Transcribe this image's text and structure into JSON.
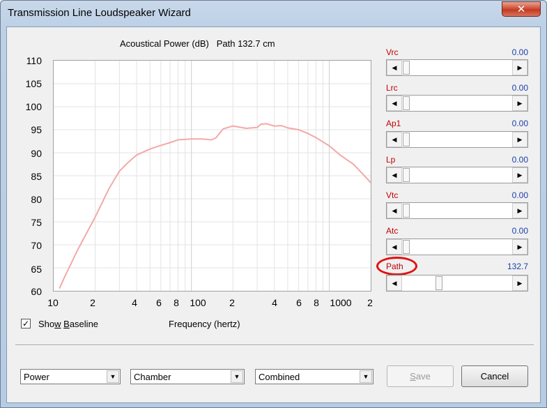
{
  "window": {
    "title": "Transmission Line Loudspeaker Wizard",
    "close_glyph": "✕"
  },
  "chart": {
    "title": "Acoustical Power (dB)   Path 132.7 cm",
    "y_ticks": [
      "110",
      "105",
      "100",
      "95",
      "90",
      "85",
      "80",
      "75",
      "70",
      "65",
      "60"
    ],
    "x_ticks": [
      "10",
      "2",
      "4",
      "6",
      "8",
      "100",
      "2",
      "4",
      "6",
      "8",
      "1000",
      "2"
    ]
  },
  "chart_data": {
    "type": "line",
    "title": "Acoustical Power (dB)   Path 132.7 cm",
    "xlabel": "Frequency (hertz)",
    "ylabel": "",
    "x_scale": "log",
    "xlim": [
      10,
      2000
    ],
    "ylim": [
      60,
      110
    ],
    "grid": true,
    "series": [
      {
        "color": "#f4a8a8",
        "x": [
          11,
          12,
          15,
          20,
          25,
          30,
          35,
          40,
          50,
          60,
          70,
          80,
          100,
          120,
          140,
          150,
          170,
          200,
          250,
          300,
          320,
          350,
          400,
          450,
          500,
          600,
          700,
          800,
          1000,
          1200,
          1500,
          1800,
          2000
        ],
        "y": [
          60.5,
          63,
          69,
          76,
          82,
          86,
          88,
          89.5,
          90.8,
          91.6,
          92.2,
          92.8,
          93.0,
          93.0,
          92.8,
          93.2,
          95.2,
          95.8,
          95.3,
          95.5,
          96.2,
          96.3,
          95.8,
          95.9,
          95.4,
          95.0,
          94.2,
          93.3,
          91.5,
          89.5,
          87.5,
          85,
          83.5
        ]
      }
    ]
  },
  "params": [
    {
      "label": "Vrc",
      "value": "0.00"
    },
    {
      "label": "Lrc",
      "value": "0.00"
    },
    {
      "label": "Ap1",
      "value": "0.00"
    },
    {
      "label": "Lp",
      "value": "0.00"
    },
    {
      "label": "Vtc",
      "value": "0.00"
    },
    {
      "label": "Atc",
      "value": "0.00"
    },
    {
      "label": "Path",
      "value": "132.7"
    }
  ],
  "arrows": {
    "left": "◀",
    "right": "▶",
    "down": "▼"
  },
  "show_baseline": {
    "label_pre": "Sho",
    "label_u": "w",
    "label_mid": " ",
    "label_u2": "B",
    "label_post": "aseline",
    "checked": "✓"
  },
  "freq_label": "Frequency (hertz)",
  "combos": {
    "mode": "Power",
    "enclosure": "Chamber",
    "output": "Combined"
  },
  "buttons": {
    "save_pre": "",
    "save_u": "S",
    "save_post": "ave",
    "cancel": "Cancel"
  }
}
